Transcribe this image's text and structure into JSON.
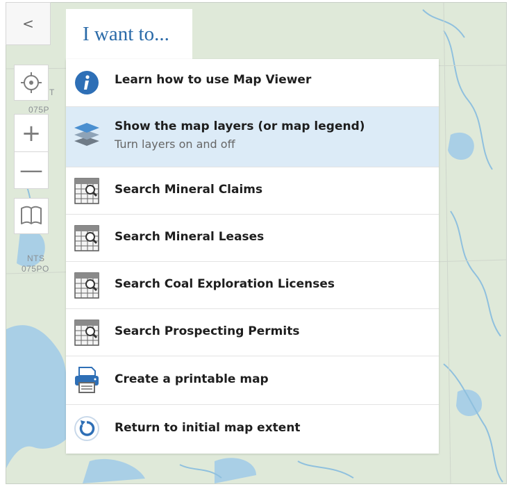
{
  "panel": {
    "title": "I want to...",
    "items": [
      {
        "icon": "info-icon",
        "label": "Learn how to use Map Viewer",
        "sublabel": ""
      },
      {
        "icon": "layers-icon",
        "label": "Show the map layers (or map legend)",
        "sublabel": "Turn layers on and off"
      },
      {
        "icon": "table-search-icon",
        "label": "Search Mineral Claims",
        "sublabel": ""
      },
      {
        "icon": "table-search-icon",
        "label": "Search Mineral Leases",
        "sublabel": ""
      },
      {
        "icon": "table-search-icon",
        "label": "Search Coal Exploration Licenses",
        "sublabel": ""
      },
      {
        "icon": "table-search-icon",
        "label": "Search Prospecting Permits",
        "sublabel": ""
      },
      {
        "icon": "printer-icon",
        "label": "Create a printable map",
        "sublabel": ""
      },
      {
        "icon": "reset-extent-icon",
        "label": "Return to initial map extent",
        "sublabel": ""
      }
    ]
  },
  "toolbar": {
    "back": {
      "icon": "chevron-left-icon",
      "glyph": "<"
    },
    "locate": {
      "icon": "locate-icon"
    },
    "zoom_in": {
      "icon": "plus-icon",
      "glyph": "+"
    },
    "zoom_out": {
      "icon": "minus-icon",
      "glyph": "—"
    },
    "bookmark": {
      "icon": "book-icon"
    }
  },
  "map": {
    "labels": [
      {
        "text": "T"
      },
      {
        "text": "075P"
      },
      {
        "text": "NTS"
      },
      {
        "text": "075PO"
      }
    ]
  },
  "colors": {
    "accent": "#2a6aa8",
    "selected_row": "#dcebf7",
    "map_land": "#dfe9d9",
    "map_water": "#a9cfe6"
  }
}
